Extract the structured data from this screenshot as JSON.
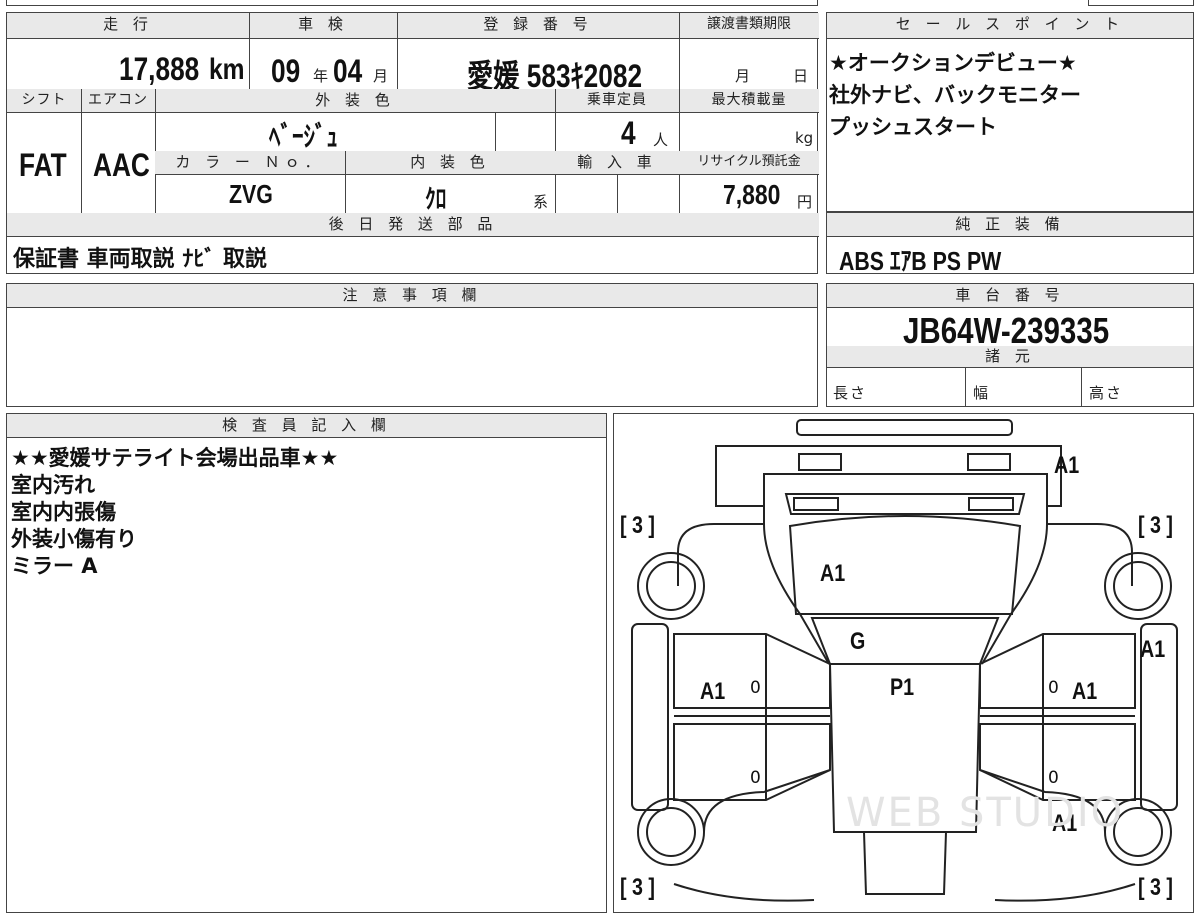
{
  "top": {
    "headers": {
      "mileage": "走 行",
      "inspection": "車 検",
      "registration": "登 録 番 号",
      "transfer_deadline": "譲渡書類期限",
      "sales_points": "セ ー ル ス ポ イ ン ト"
    },
    "mileage_value": "17,888",
    "mileage_unit": "km",
    "inspection_year": "09",
    "year_char": "年",
    "inspection_month": "04",
    "month_char": "月",
    "registration_number": "愛媛 583ｷ2082",
    "deadline_month": "月",
    "deadline_day": "日"
  },
  "spec": {
    "headers": {
      "shift": "シフト",
      "aircon": "エアコン",
      "exterior_color": "外 装 色",
      "capacity": "乗車定員",
      "max_load": "最大積載量",
      "color_no": "カ ラ ー Ｎｏ．",
      "interior_color": "内 装 色",
      "import": "輸 入 車",
      "recycle": "リサイクル預託金"
    },
    "shift_value": "FAT",
    "aircon_value": "AAC",
    "exterior_color_value": "ﾍﾞｰｼﾞｭ",
    "capacity_value": "4",
    "capacity_unit": "人",
    "load_unit": "kg",
    "color_no_value": "ZVG",
    "interior_color_value": "ｸﾛ",
    "interior_suffix": "系",
    "recycle_value": "7,880",
    "recycle_unit": "円"
  },
  "later_items": {
    "header": "後 日 発 送 部 品",
    "value": "保証書 車両取説 ﾅﾋﾞ 取説"
  },
  "sales_points": {
    "lines": [
      "★オークションデビュー★",
      "社外ナビ、バックモニター",
      "プッシュスタート"
    ]
  },
  "genuine_equipment": {
    "header": "純 正 装 備",
    "value": "ABS ｴｱB PS PW"
  },
  "notes": {
    "header": "注 意 事 項 欄"
  },
  "chassis": {
    "header": "車 台 番 号",
    "value": "JB64W-239335",
    "specs_header": "諸 元",
    "length_label": "長さ",
    "width_label": "幅",
    "height_label": "高さ"
  },
  "inspector": {
    "header": "検 査 員 記 入 欄",
    "lines": [
      "★★愛媛サテライト会場出品車★★",
      "室内汚れ",
      "室内内張傷",
      "外装小傷有り",
      "ミラー A"
    ]
  },
  "diagram": {
    "tire_marks": [
      "[ 3 ]",
      "[ 3 ]",
      "[ 3 ]",
      "[ 3 ]"
    ],
    "marks": {
      "rear_top": "A1",
      "roof": "A1",
      "glass": "G",
      "hood": "P1",
      "left_door": "A1",
      "right_door": "A1",
      "right_fender": "A1",
      "right_front": "A1",
      "left_small_1": "0",
      "right_small_1": "0",
      "left_small_2": "0",
      "right_small_2": "0"
    },
    "watermark": "WEB STUDIO"
  }
}
